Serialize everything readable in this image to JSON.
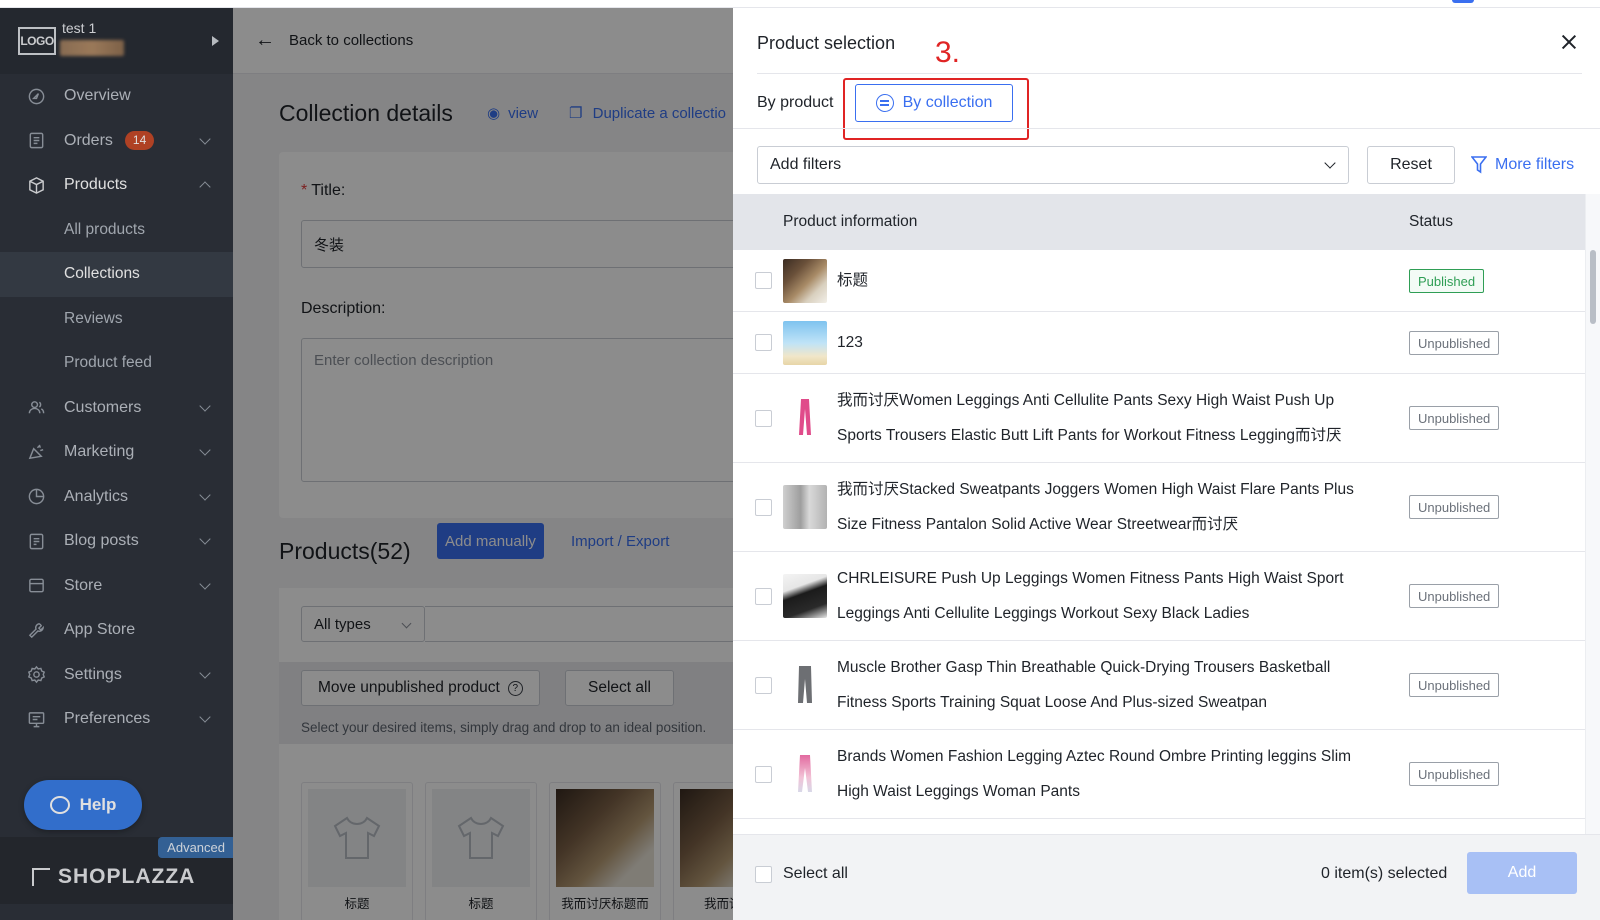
{
  "sidebar": {
    "logo_text": "LOGO",
    "store_name": "test 1",
    "items": [
      {
        "label": "Overview"
      },
      {
        "label": "Orders",
        "badge": "14"
      },
      {
        "label": "Products"
      },
      {
        "label": "All products"
      },
      {
        "label": "Collections"
      },
      {
        "label": "Reviews"
      },
      {
        "label": "Product feed"
      },
      {
        "label": "Customers"
      },
      {
        "label": "Marketing"
      },
      {
        "label": "Analytics"
      },
      {
        "label": "Blog posts"
      },
      {
        "label": "Store"
      },
      {
        "label": "App Store"
      },
      {
        "label": "Settings"
      },
      {
        "label": "Preferences"
      }
    ],
    "help_label": "Help",
    "plan_tag": "Advanced",
    "brand": "SHOPLAZZA"
  },
  "main": {
    "back_label": "Back to collections",
    "page_title": "Collection details",
    "view_label": "view",
    "duplicate_label": "Duplicate a collectio",
    "title_label": "Title:",
    "title_value": "冬装",
    "description_label": "Description:",
    "description_placeholder": "Enter collection description",
    "products_title": "Products(52)",
    "add_manually_label": "Add manually",
    "import_export_label": "Import / Export",
    "type_select": "All types",
    "move_unpublished_label": "Move unpublished product",
    "select_all_label": "Select all",
    "hint_text": "Select your desired items, simply drag and drop to an ideal position.",
    "thumbs": [
      {
        "caption": "标题"
      },
      {
        "caption": "标题"
      },
      {
        "caption": "我而讨厌标题而"
      },
      {
        "caption": "我而讨厌"
      }
    ]
  },
  "drawer": {
    "title": "Product selection",
    "step_annotation": "3.",
    "tab_by_product": "By product",
    "tab_by_collection": "By collection",
    "filter_placeholder": "Add filters",
    "reset_label": "Reset",
    "more_filters_label": "More filters",
    "columns": [
      "Product information",
      "Status"
    ],
    "rows": [
      {
        "title": "标题",
        "status": "Published"
      },
      {
        "title": "123",
        "status": "Unpublished"
      },
      {
        "title": "我而讨厌Women Leggings Anti Cellulite Pants Sexy High Waist Push Up Sports Trousers Elastic Butt Lift Pants for Workout Fitness Legging而讨厌",
        "status": "Unpublished"
      },
      {
        "title": "我而讨厌Stacked Sweatpants Joggers Women High Waist Flare Pants Plus Size Fitness Pantalon Solid Active Wear Streetwear而讨厌",
        "status": "Unpublished"
      },
      {
        "title": "CHRLEISURE Push Up Leggings Women Fitness Pants High Waist Sport Leggings Anti Cellulite Leggings Workout Sexy Black Ladies",
        "status": "Unpublished"
      },
      {
        "title": "Muscle Brother Gasp Thin Breathable Quick-Drying Trousers Basketball Fitness Sports Training Squat Loose And Plus-sized Sweatpan",
        "status": "Unpublished"
      },
      {
        "title": "Brands Women Fashion Legging Aztec Round Ombre Printing leggins Slim High Waist Leggings Woman Pants",
        "status": "Unpublished"
      }
    ],
    "footer_select_all": "Select all",
    "selected_count": "0 item(s) selected",
    "add_label": "Add"
  },
  "colors": {
    "accent": "#3a6ff0",
    "annotation_red": "#e02424",
    "sidebar_bg": "#2f343d",
    "published_green": "#2f9e55"
  }
}
